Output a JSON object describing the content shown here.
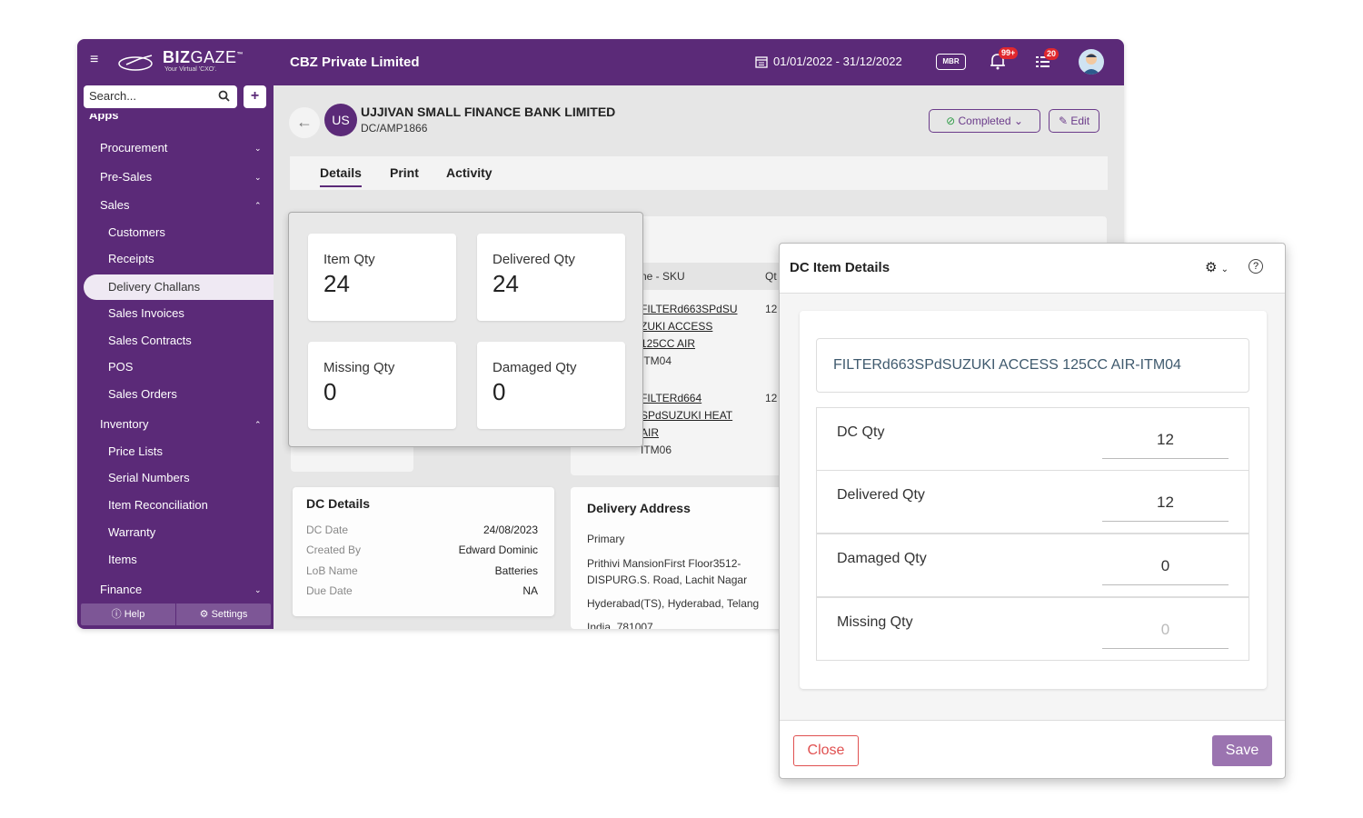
{
  "topbar": {
    "logo_text_bold": "BIZ",
    "logo_text_light": "GAZE",
    "logo_tm": "™",
    "logo_tagline": "Your Virtual 'CXO'.",
    "company": "CBZ Private Limited",
    "date_range": "01/01/2022 - 31/12/2022",
    "mbr_label": "MBR",
    "notifications_count": "99+",
    "tasks_count": "20"
  },
  "sidebar": {
    "search_placeholder": "Search...",
    "apps_label": "Apps",
    "items": [
      {
        "label": "Procurement",
        "chev": "⌄"
      },
      {
        "label": "Pre-Sales",
        "chev": "⌄"
      },
      {
        "label": "Sales",
        "chev": "⌃"
      },
      {
        "label": "Customers"
      },
      {
        "label": "Receipts"
      },
      {
        "label": "Delivery Challans"
      },
      {
        "label": "Sales Invoices"
      },
      {
        "label": "Sales Contracts"
      },
      {
        "label": "POS"
      },
      {
        "label": "Sales Orders"
      },
      {
        "label": "Inventory",
        "chev": "⌃"
      },
      {
        "label": "Price Lists"
      },
      {
        "label": "Serial Numbers"
      },
      {
        "label": "Item Reconciliation"
      },
      {
        "label": "Warranty"
      },
      {
        "label": "Items"
      },
      {
        "label": "Finance",
        "chev": "⌄"
      }
    ],
    "help_label": "Help",
    "settings_label": "Settings"
  },
  "header": {
    "avatar_initials": "US",
    "customer_name": "UJJIVAN SMALL FINANCE BANK LIMITED",
    "doc_code": "DC/AMP1866",
    "status": "Completed",
    "edit_label": "Edit"
  },
  "tabs": [
    "Details",
    "Print",
    "Activity"
  ],
  "items_table": {
    "header_name": "ne - SKU",
    "header_qty": "Qt",
    "rows": [
      {
        "lines": [
          "FILTERd663SPdSU",
          "ZUKI ACCESS",
          "125CC AIR"
        ],
        "code": "ITM04",
        "qty": "12"
      },
      {
        "lines": [
          "FILTERd664",
          "SPdSUZUKI HEAT",
          "AIR"
        ],
        "code": "ITM06",
        "qty": "12"
      }
    ]
  },
  "qty_summary": [
    {
      "label": "Item Qty",
      "value": "24"
    },
    {
      "label": "Delivered Qty",
      "value": "24"
    },
    {
      "label": "Missing Qty",
      "value": "0"
    },
    {
      "label": "Damaged Qty",
      "value": "0"
    }
  ],
  "dc_details": {
    "title": "DC Details",
    "rows": [
      {
        "key": "DC Date",
        "value": "24/08/2023"
      },
      {
        "key": "Created By",
        "value": "Edward Dominic"
      },
      {
        "key": "LoB Name",
        "value": "Batteries"
      },
      {
        "key": "Due Date",
        "value": "NA"
      }
    ]
  },
  "delivery_address": {
    "title": "Delivery Address",
    "type": "Primary",
    "line1": "Prithivi MansionFirst Floor3512-",
    "line2": "DISPURG.S. Road, Lachit Nagar",
    "line3": "Hyderabad(TS), Hyderabad, Telang",
    "line4": "India, 781007"
  },
  "dialog": {
    "title": "DC Item Details",
    "item_name": "FILTERd663SPdSUZUKI ACCESS 125CC AIR-ITM04",
    "fields": [
      {
        "label": "DC Qty",
        "value": "12"
      },
      {
        "label": "Delivered Qty",
        "value": "12"
      },
      {
        "label": "Damaged Qty",
        "value": "0"
      },
      {
        "label": "Missing Qty",
        "value": "0"
      }
    ],
    "close_label": "Close",
    "save_label": "Save"
  },
  "colors": {
    "brand": "#5b2a78",
    "accent": "#9b74b0",
    "success": "#2e9b46",
    "danger": "#e05050"
  }
}
